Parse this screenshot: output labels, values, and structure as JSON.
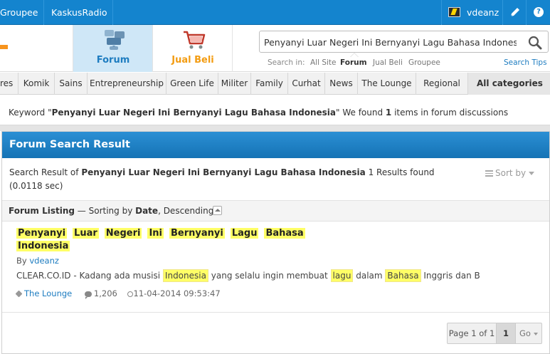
{
  "topbar": {
    "links": [
      "Groupee",
      "KaskusRadio"
    ],
    "username": "vdeanz",
    "colors": {
      "bar": "#1484ce"
    }
  },
  "header": {
    "nav": [
      {
        "label": "Forum",
        "icon": "forum-icon",
        "active": true
      },
      {
        "label": "Jual Beli",
        "icon": "shopping-cart-icon",
        "active": false
      }
    ],
    "search": {
      "value": "Penyanyi Luar Negeri Ini Bernyanyi Lagu Bahasa Indonesia",
      "search_in_label": "Search in:",
      "options": [
        "All Site",
        "Forum",
        "Jual Beli",
        "Groupee"
      ],
      "active_option": "Forum",
      "tips": "Search Tips"
    }
  },
  "categories": {
    "items": [
      "res",
      "Komik",
      "Sains",
      "Entrepreneurship",
      "Green Life",
      "Militer",
      "Family",
      "Curhat",
      "News",
      "The Lounge",
      "Regional"
    ],
    "all": "All categories"
  },
  "keyword_info": {
    "prefix": "Keyword \"",
    "keyword": "Penyanyi Luar Negeri Ini Bernyanyi Lagu Bahasa Indonesia",
    "middle": "\" We found ",
    "count": "1",
    "suffix": " items in forum discussions"
  },
  "panel": {
    "title": "Forum Search Result",
    "summary_prefix": "Search Result of ",
    "summary_keyword": "Penyanyi Luar Negeri Ini Bernyanyi Lagu Bahasa Indonesia",
    "summary_suffix": " 1 Results found (0.0118 sec)",
    "sort_by": "Sort by",
    "listing_label": "Forum Listing",
    "listing_sort_prefix": " — Sorting by ",
    "listing_sort_field": "Date",
    "listing_sort_order": ", Descending"
  },
  "thread": {
    "title_words_line1": [
      "Penyanyi",
      "Luar",
      "Negeri",
      "Ini",
      "Bernyanyi",
      "Lagu",
      "Bahasa"
    ],
    "title_words_line2": [
      "Indonesia"
    ],
    "by_label": "By ",
    "author": "vdeanz",
    "snippet": {
      "s1": "CLEAR.CO.ID - Kadang ada musisi ",
      "h1": "Indonesia",
      "s2": " yang selalu ingin membuat ",
      "h2": "lagu",
      "s3": " dalam ",
      "h3": "Bahasa",
      "s4": " Inggris dan B"
    },
    "forum": "The Lounge",
    "replies": "1,206",
    "date": "11-04-2014 09:53:47"
  },
  "pager": {
    "info": "Page 1 of 1",
    "current": "1",
    "go": "Go"
  }
}
